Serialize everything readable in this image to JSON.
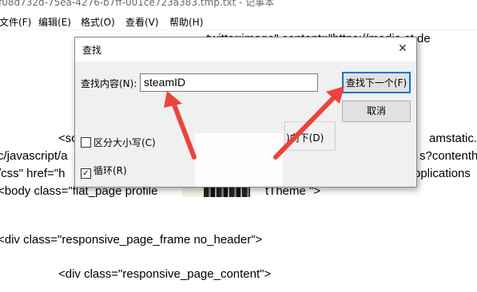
{
  "window": {
    "title": "f08d732d-75ea-4276-b7ff-001ce723a383.tmp.txt - 记事本"
  },
  "menu": {
    "file": "文件(F)",
    "edit": "编辑(E)",
    "format": "格式(O)",
    "view": "查看(V)",
    "help": "帮助(H)"
  },
  "editor": {
    "line1": "..twitter:image\" content=\"https://media.st.de",
    "line2": "<sc",
    "line2_right": "amstatic.c",
    "line3": "c/javascript/a",
    "line3_right": "s?contenth",
    "line4": "/css\" href=\"h",
    "line4_right": "pplications",
    "line5_left": "<body class=\"flat_page profile",
    "line5_right": "tTheme \">",
    "line6": "<div class=\"responsive_page_frame no_header\">",
    "line7": "<div class=\"responsive_page_content\">"
  },
  "dialog": {
    "title": "查找",
    "close": "✕",
    "find_label": "查找内容(N):",
    "find_value": "steamID",
    "find_next": "查找下一个(F)",
    "cancel": "取消",
    "direction_down": ")向下(D)",
    "match_case": "区分大小写(C)",
    "wrap": "循环(R)",
    "wrap_checked": true,
    "match_case_checked": false
  },
  "colors": {
    "arrow": "#e8453c",
    "focus": "#0078d7"
  }
}
